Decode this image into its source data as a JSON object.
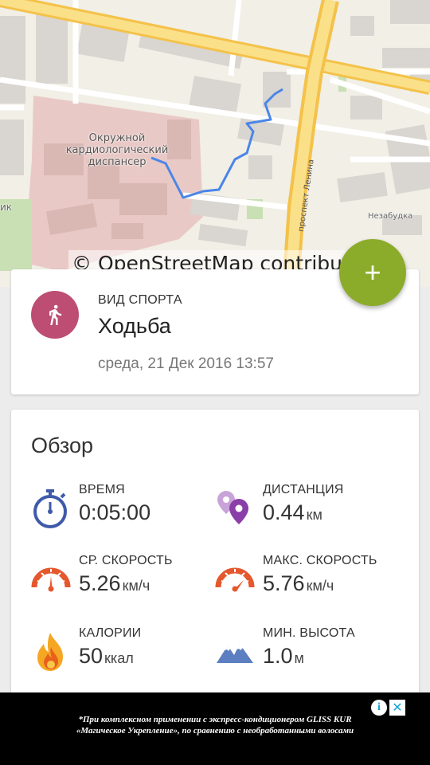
{
  "map": {
    "labels": {
      "hospital": "Окружной кардиологический диспансер",
      "street": "проспект Ленина",
      "poi": "Незабудка",
      "edge": "ик"
    },
    "attribution": "© OpenStreetMap contributors",
    "route_color": "#4a86e8"
  },
  "fab": {
    "icon": "plus-icon",
    "label": "+"
  },
  "activity": {
    "sport_label": "ВИД СПОРТА",
    "sport_name": "Ходьба",
    "date": "среда, 21 Дек  2016 13:57",
    "icon": "walking-person-icon",
    "color": "#bd4d73"
  },
  "overview": {
    "title": "Обзор",
    "stats": [
      {
        "label": "ВРЕМЯ",
        "value": "0:05:00",
        "unit": "",
        "icon": "stopwatch-icon"
      },
      {
        "label": "ДИСТАНЦИЯ",
        "value": "0.44",
        "unit": "км",
        "icon": "map-pins-icon"
      },
      {
        "label": "СР. СКОРОСТЬ",
        "value": "5.26",
        "unit": "км/ч",
        "icon": "speedometer-icon"
      },
      {
        "label": "МАКС. СКОРОСТЬ",
        "value": "5.76",
        "unit": "км/ч",
        "icon": "speedometer-max-icon"
      },
      {
        "label": "КАЛОРИИ",
        "value": "50",
        "unit": "ккал",
        "icon": "flame-icon"
      },
      {
        "label": "МИН. ВЫСОТА",
        "value": "1.0",
        "unit": "м",
        "icon": "mountains-icon"
      }
    ]
  },
  "ad": {
    "text_line1": "*При комплексном применении с экспресс-кондиционером GLISS KUR",
    "text_line2": "«Магическое Укрепление», по сравнению с необработанными волосами",
    "info_icon": "i",
    "close_icon": "✕"
  }
}
